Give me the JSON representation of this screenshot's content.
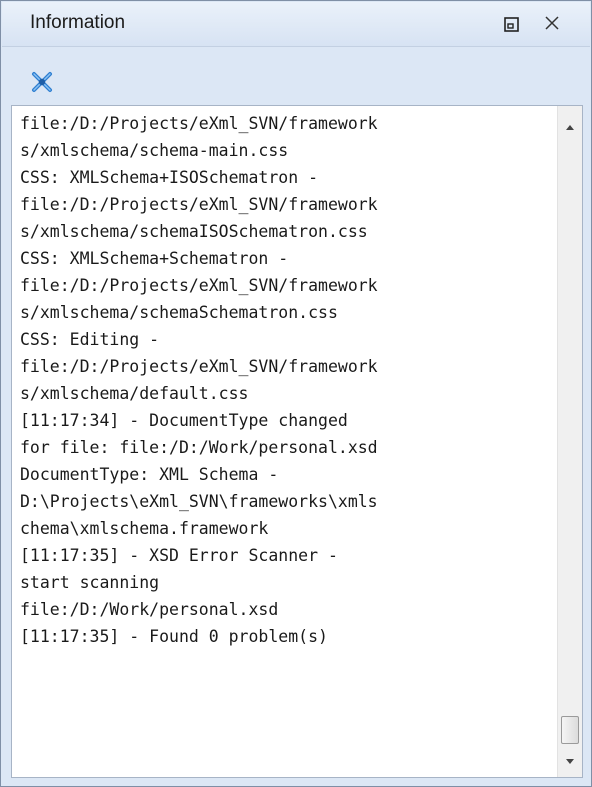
{
  "panel": {
    "title": "Information",
    "buttons": {
      "restore_icon": "restore-view-icon",
      "close_icon": "close-icon"
    }
  },
  "toolbar": {
    "clear_icon": "clear-log-icon",
    "accent": "#3a83c8"
  },
  "log": {
    "lines": [
      "file:/D:/Projects/eXml_SVN/framework",
      "s/xmlschema/schema-main.css",
      "CSS: XMLSchema+ISOSchematron -",
      "file:/D:/Projects/eXml_SVN/framework",
      "s/xmlschema/schemaISOSchematron.css",
      "CSS: XMLSchema+Schematron -",
      "file:/D:/Projects/eXml_SVN/framework",
      "s/xmlschema/schemaSchematron.css",
      "CSS: Editing -",
      "file:/D:/Projects/eXml_SVN/framework",
      "s/xmlschema/default.css",
      "[11:17:34] - DocumentType changed",
      "for file: file:/D:/Work/personal.xsd",
      "DocumentType: XML Schema -",
      "D:\\Projects\\eXml_SVN\\frameworks\\xmls",
      "chema\\xmlschema.framework",
      "[11:17:35] - XSD Error Scanner -",
      "start scanning",
      "file:/D:/Work/personal.xsd",
      "[11:17:35] - Found 0 problem(s)"
    ]
  }
}
